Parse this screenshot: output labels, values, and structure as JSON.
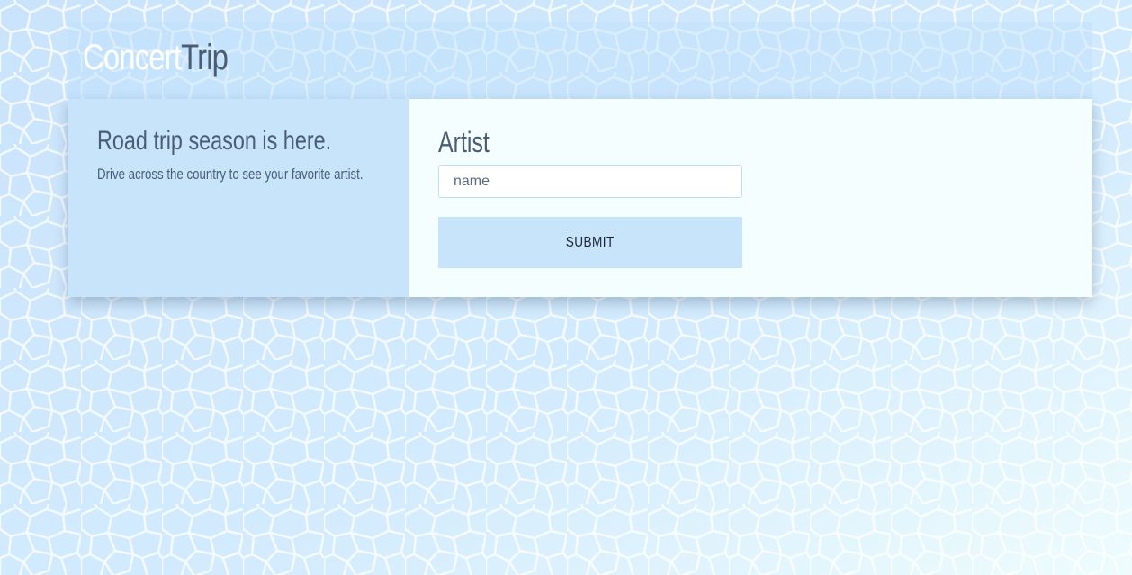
{
  "app": {
    "logo_part1": "Concert",
    "logo_part2": "Trip"
  },
  "hero": {
    "tagline": "Road trip season is here.",
    "subtagline": "Drive across the country to see your favorite artist."
  },
  "form": {
    "artist_label": "Artist",
    "artist_placeholder": "name",
    "artist_value": "",
    "submit_label": "SUBMIT"
  },
  "colors": {
    "background": "#d6ecfd",
    "card_left": "#c7e4fb",
    "card_right": "#f5fefe",
    "text": "#4a5d75",
    "button": "#c7e4fb"
  }
}
